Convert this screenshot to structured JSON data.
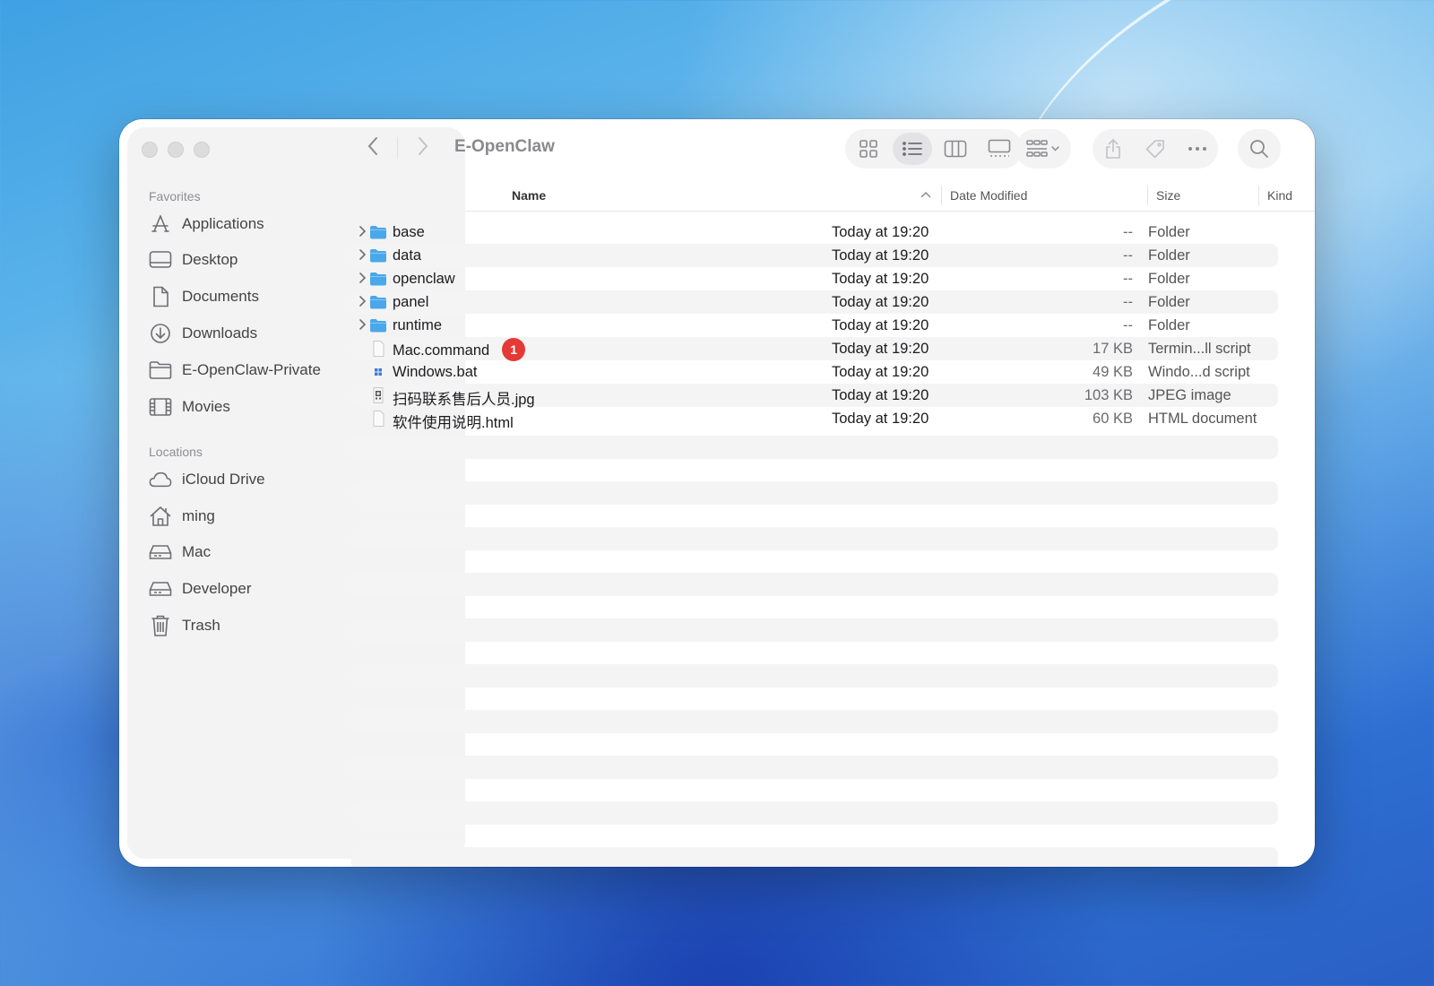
{
  "window": {
    "title": "E-OpenClaw"
  },
  "sidebar": {
    "favorites_label": "Favorites",
    "favorites": [
      {
        "label": "Applications",
        "icon": "applications-icon"
      },
      {
        "label": "Desktop",
        "icon": "desktop-icon"
      },
      {
        "label": "Documents",
        "icon": "document-icon"
      },
      {
        "label": "Downloads",
        "icon": "download-icon"
      },
      {
        "label": "E-OpenClaw-Private",
        "icon": "folder-icon"
      },
      {
        "label": "Movies",
        "icon": "film-icon"
      }
    ],
    "locations_label": "Locations",
    "locations": [
      {
        "label": "iCloud Drive",
        "icon": "cloud-icon"
      },
      {
        "label": "ming",
        "icon": "home-icon"
      },
      {
        "label": "Mac",
        "icon": "drive-icon"
      },
      {
        "label": "Developer",
        "icon": "drive-icon"
      },
      {
        "label": "Trash",
        "icon": "trash-icon"
      }
    ]
  },
  "columns": {
    "name": "Name",
    "date": "Date Modified",
    "size": "Size",
    "kind": "Kind"
  },
  "files": [
    {
      "name": "base",
      "date": "Today at 19:20",
      "size": "--",
      "kind": "Folder",
      "type": "folder"
    },
    {
      "name": "data",
      "date": "Today at 19:20",
      "size": "--",
      "kind": "Folder",
      "type": "folder"
    },
    {
      "name": "openclaw",
      "date": "Today at 19:20",
      "size": "--",
      "kind": "Folder",
      "type": "folder"
    },
    {
      "name": "panel",
      "date": "Today at 19:20",
      "size": "--",
      "kind": "Folder",
      "type": "folder"
    },
    {
      "name": "runtime",
      "date": "Today at 19:20",
      "size": "--",
      "kind": "Folder",
      "type": "folder"
    },
    {
      "name": "Mac.command",
      "date": "Today at 19:20",
      "size": "17 KB",
      "kind": "Termin...ll script",
      "type": "script",
      "badge": "1"
    },
    {
      "name": "Windows.bat",
      "date": "Today at 19:20",
      "size": "49 KB",
      "kind": "Windo...d script",
      "type": "bat"
    },
    {
      "name": "扫码联系售后人员.jpg",
      "date": "Today at 19:20",
      "size": "103 KB",
      "kind": "JPEG image",
      "type": "image"
    },
    {
      "name": "软件使用说明.html",
      "date": "Today at 19:20",
      "size": "60 KB",
      "kind": "HTML document",
      "type": "html"
    }
  ],
  "colors": {
    "folder": "#4aa8ea",
    "badge": "#e53935",
    "window_bg": "#ffffff",
    "sidebar_bg": "#f3f3f4"
  }
}
